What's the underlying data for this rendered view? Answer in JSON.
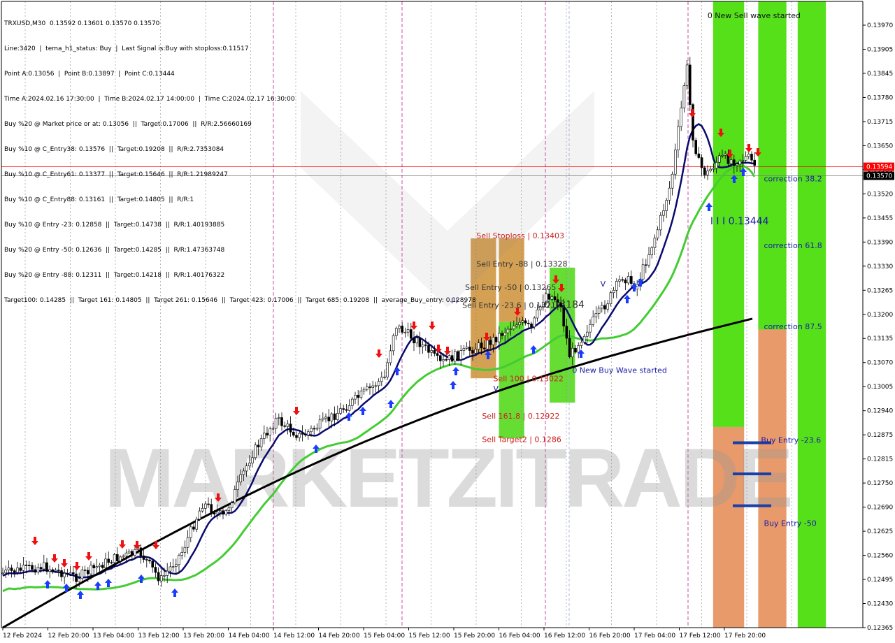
{
  "header": {
    "lines": [
      "TRXUSD,M30  0.13592 0.13601 0.13570 0.13570",
      "Line:3420  |  tema_h1_status: Buy  |  Last Signal is:Buy with stoploss:0.11517",
      "Point A:0.13056  |  Point B:0.13897  |  Point C:0.13444",
      "Time A:2024.02.16 17:30:00  |  Time B:2024.02.17 14:00:00  |  Time C:2024.02.17 16:30:00",
      "Buy %20 @ Market price or at: 0.13056  ||  Target:0.17006  ||  R/R:2.56660169",
      "Buy %10 @ C_Entry38: 0.13576  ||  Target:0.19208  ||  R/R:2.7353084",
      "Buy %10 @ C_Entry61: 0.13377  ||  Target:0.15646  ||  R/R:1.21989247",
      "Buy %10 @ C_Entry88: 0.13161  ||  Target:0.14805  ||  R/R:1",
      "Buy %10 @ Entry -23: 0.12858  ||  Target:0.14738  ||  R/R:1.40193885",
      "Buy %20 @ Entry -50: 0.12636  ||  Target:0.14285  ||  R/R:1.47363748",
      "Buy %20 @ Entry -88: 0.12311  ||  Target:0.14218  ||  R/R:1.40176322",
      "Target100: 0.14285  ||  Target 161: 0.14805  ||  Target 261: 0.15646  ||  Target 423: 0.17006  ||  Target 685: 0.19208  ||  average_Buy_entry: 0.128978"
    ]
  },
  "watermark": "MARKETZITRADE",
  "chart_data": {
    "type": "candlestick",
    "symbol": "TRXUSD",
    "timeframe": "M30",
    "y_axis": {
      "range": [
        0.12365,
        0.14035
      ],
      "ticks": [
        "0.13970",
        "0.13905",
        "0.13845",
        "0.13780",
        "0.13715",
        "0.13650",
        "0.13585",
        "0.13520",
        "0.13455",
        "0.13390",
        "0.13330",
        "0.13265",
        "0.13200",
        "0.13135",
        "0.13070",
        "0.13005",
        "0.12940",
        "0.12875",
        "0.12815",
        "0.12750",
        "0.12690",
        "0.12625",
        "0.12560",
        "0.12495",
        "0.12430",
        "0.12365"
      ]
    },
    "x_axis": {
      "labels": [
        "12 Feb 2024",
        "12 Feb 20:00",
        "13 Feb 04:00",
        "13 Feb 12:00",
        "13 Feb 20:00",
        "14 Feb 04:00",
        "14 Feb 12:00",
        "14 Feb 20:00",
        "15 Feb 04:00",
        "15 Feb 12:00",
        "15 Feb 20:00",
        "16 Feb 04:00",
        "16 Feb 12:00",
        "16 Feb 20:00",
        "17 Feb 04:00",
        "17 Feb 12:00",
        "17 Feb 20:00"
      ]
    },
    "price_markers": [
      {
        "value": 0.13594,
        "label": "0.13594",
        "color": "#ff0000"
      },
      {
        "value": 0.1357,
        "label": "0.13570",
        "color": "#000000"
      }
    ],
    "zones": [
      {
        "name": "sell-stoploss-zone",
        "color": "#d4a054",
        "x0": "15 Feb 11:00",
        "x1": "15 Feb 15:30",
        "y0": 0.13403,
        "y1": 0.1303
      },
      {
        "name": "sell-target-zone-upper",
        "color": "#d4a054",
        "x0": "15 Feb 16:00",
        "x1": "15 Feb 20:30",
        "y0": 0.13403,
        "y1": 0.1318
      },
      {
        "name": "sell-target-zone-lower",
        "color": "#66dd33",
        "x0": "15 Feb 16:00",
        "x1": "15 Feb 20:30",
        "y0": 0.1318,
        "y1": 0.1287
      },
      {
        "name": "sell-entry-zone",
        "color": "#66dd33",
        "x0": "16 Feb 01:00",
        "x1": "16 Feb 05:30",
        "y0": 0.13325,
        "y1": 0.12965
      },
      {
        "name": "buy-zone-1-green",
        "color": "#55e01a",
        "x0": "17 Feb 06:00",
        "x1": "17 Feb 11:30",
        "y0": 0.14035,
        "y1": 0.129
      },
      {
        "name": "buy-zone-1-orange",
        "color": "#e89a6a",
        "x0": "17 Feb 06:00",
        "x1": "17 Feb 11:30",
        "y0": 0.129,
        "y1": 0.12365
      },
      {
        "name": "buy-zone-2-green",
        "color": "#55e01a",
        "x0": "17 Feb 14:00",
        "x1": "17 Feb 19:00",
        "y0": 0.14035,
        "y1": 0.1316
      },
      {
        "name": "buy-zone-2-orange",
        "color": "#e89a6a",
        "x0": "17 Feb 14:00",
        "x1": "17 Feb 19:00",
        "y0": 0.1316,
        "y1": 0.12365
      },
      {
        "name": "buy-zone-3-green",
        "color": "#55e01a",
        "x0": "17 Feb 21:00",
        "x1": "18 Feb 02:00",
        "y0": 0.14035,
        "y1": 0.12365
      }
    ],
    "annotations": [
      {
        "text": "Sell Stoploss | 0.13403",
        "color": "#cc2222",
        "at": [
          "15 Feb 12:00",
          0.13403
        ]
      },
      {
        "text": "Sell Entry -88 | 0.13328",
        "color": "#333333",
        "at": [
          "15 Feb 12:00",
          0.13328
        ]
      },
      {
        "text": "Sell Entry -50 | 0.13265",
        "color": "#333333",
        "at": [
          "15 Feb 10:00",
          0.13265
        ]
      },
      {
        "text": "Sell Entry -23.6 | 0.13218",
        "color": "#333333",
        "at": [
          "15 Feb 09:30",
          0.13218
        ]
      },
      {
        "text": "0.13184",
        "color": "#333333",
        "at": [
          "16 Feb 00:00",
          0.13218
        ]
      },
      {
        "text": "Sell 100 | 0.13022",
        "color": "#cc2222",
        "at": [
          "15 Feb 15:00",
          0.13022
        ]
      },
      {
        "text": "Sell 161.8 | 0.12922",
        "color": "#cc2222",
        "at": [
          "15 Feb 13:00",
          0.12922
        ]
      },
      {
        "text": "Sell Target2 | 0.1286",
        "color": "#cc2222",
        "at": [
          "15 Feb 13:00",
          0.1286
        ]
      },
      {
        "text": "0 New Buy Wave started",
        "color": "#1a1aa8",
        "at": [
          "16 Feb 05:00",
          0.13044
        ]
      },
      {
        "text": "0 New Sell wave started",
        "color": "#111111",
        "at": [
          "17 Feb 05:00",
          0.1399
        ]
      },
      {
        "text": "correction 38.2",
        "color": "#1a1aa8",
        "at": [
          "17 Feb 15:00",
          0.13555
        ]
      },
      {
        "text": "I I I 0.13444",
        "color": "#1a1aa8",
        "at": [
          "17 Feb 05:30",
          0.1344
        ]
      },
      {
        "text": "correction 61.8",
        "color": "#1a1aa8",
        "at": [
          "17 Feb 15:00",
          0.13377
        ]
      },
      {
        "text": "correction 87.5",
        "color": "#1a1aa8",
        "at": [
          "17 Feb 15:00",
          0.13161
        ]
      },
      {
        "text": "Buy Entry -23.6",
        "color": "#1a1aa8",
        "at": [
          "17 Feb 14:30",
          0.12858
        ]
      },
      {
        "text": "Buy Entry -50",
        "color": "#1a1aa8",
        "at": [
          "17 Feb 15:00",
          0.12636
        ]
      },
      {
        "text": "V",
        "color": "#1a1aa8",
        "at": [
          "16 Feb 10:00",
          0.13275
        ]
      },
      {
        "text": "V",
        "color": "#1a1aa8",
        "at": [
          "15 Feb 15:00",
          0.12995
        ]
      },
      {
        "text": "I I",
        "color": "#1a1aa8",
        "at": [
          "15 Feb 07:30",
          0.1323
        ]
      }
    ],
    "buy_entry_lines": [
      {
        "value": 0.12858,
        "color": "#1a3fa8"
      },
      {
        "value": 0.12775,
        "color": "#1a3fa8"
      },
      {
        "value": 0.1269,
        "color": "#1a3fa8"
      }
    ],
    "moving_averages": [
      {
        "color": "#0a0a6e",
        "kind": "fast"
      },
      {
        "color": "#44cc33",
        "kind": "mid"
      },
      {
        "color": "#000000",
        "kind": "slow"
      }
    ]
  }
}
